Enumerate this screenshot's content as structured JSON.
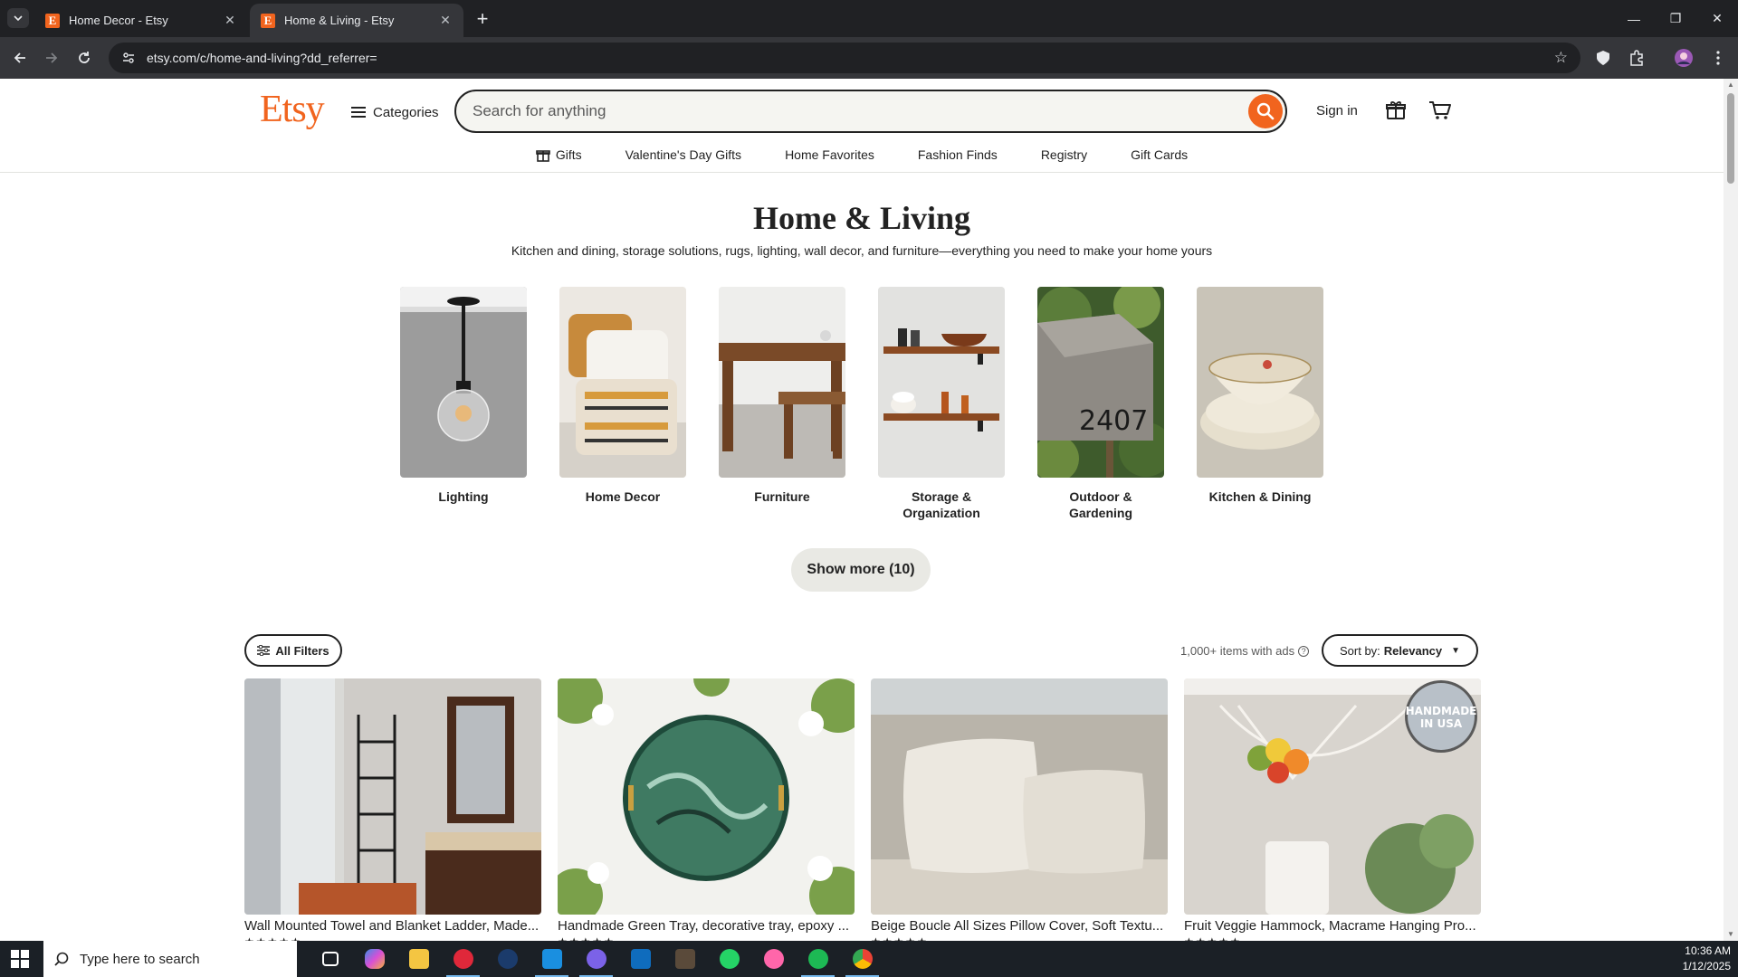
{
  "browser": {
    "tabs": [
      {
        "title": "Home Decor - Etsy",
        "favicon": "E"
      },
      {
        "title": "Home & Living - Etsy",
        "favicon": "E"
      }
    ],
    "url": "etsy.com/c/home-and-living?dd_referrer="
  },
  "header": {
    "logo": "Etsy",
    "categories_label": "Categories",
    "search_placeholder": "Search for anything",
    "signin_label": "Sign in"
  },
  "subnav": [
    {
      "label": "Gifts"
    },
    {
      "label": "Valentine's Day Gifts"
    },
    {
      "label": "Home Favorites"
    },
    {
      "label": "Fashion Finds"
    },
    {
      "label": "Registry"
    },
    {
      "label": "Gift Cards"
    }
  ],
  "main": {
    "title": "Home & Living",
    "subtitle": "Kitchen and dining, storage solutions, rugs, lighting, wall decor, and furniture—everything you need to make your home yours",
    "categories": [
      {
        "label": "Lighting"
      },
      {
        "label": "Home Decor"
      },
      {
        "label": "Furniture"
      },
      {
        "label": "Storage & Organization"
      },
      {
        "label": "Outdoor & Gardening"
      },
      {
        "label": "Kitchen & Dining"
      }
    ],
    "show_more_label": "Show more (10)",
    "filters_label": "All Filters",
    "items_count": "1,000+ items with ads",
    "sort_prefix": "Sort by:",
    "sort_value": "Relevancy",
    "listings": [
      {
        "title": "Wall Mounted Towel and Blanket Ladder, Made..."
      },
      {
        "title": "Handmade Green Tray, decorative tray, epoxy ..."
      },
      {
        "title": "Beige Boucle All Sizes Pillow Cover, Soft Textu..."
      },
      {
        "title": "Fruit Veggie Hammock, Macrame Hanging Pro...",
        "badge": "HANDMADE IN USA"
      }
    ]
  },
  "taskbar": {
    "search_placeholder": "Type here to search",
    "time": "10:36 AM",
    "date": "1/12/2025"
  },
  "colors": {
    "brand": "#f1641e",
    "chrome_dark": "#202124",
    "chrome_mid": "#35363a"
  }
}
